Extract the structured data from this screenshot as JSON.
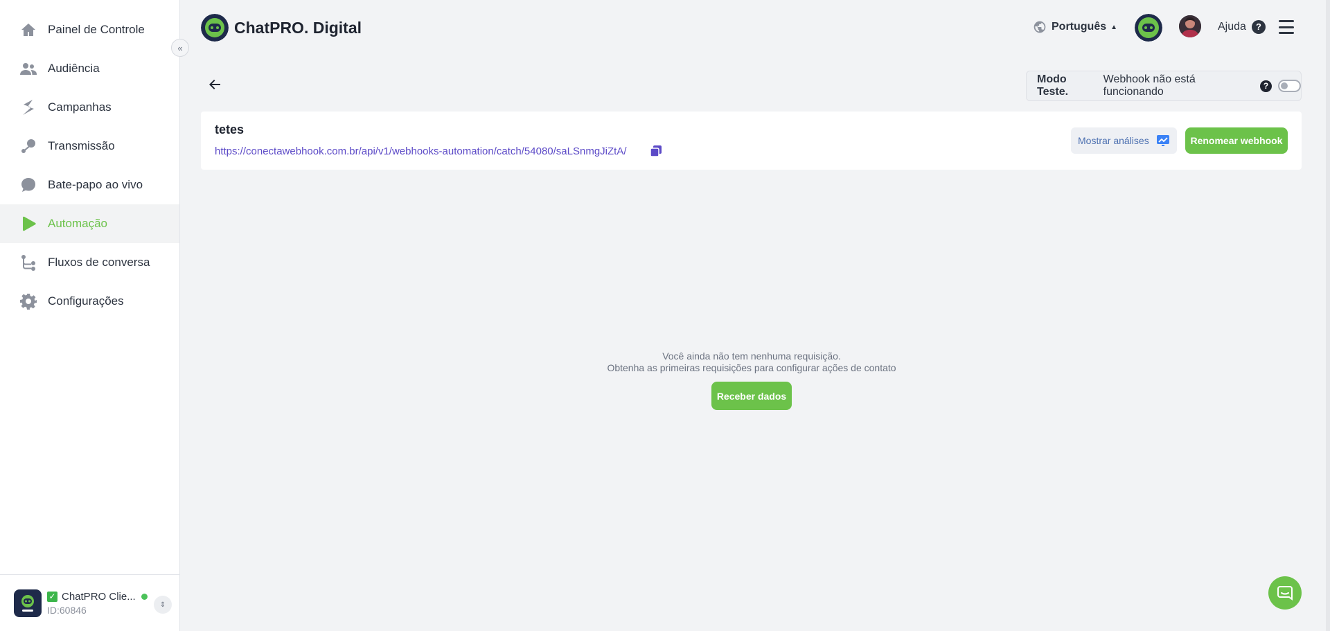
{
  "brand": {
    "name": "ChatPRO. Digital"
  },
  "sidebar": {
    "items": [
      {
        "label": "Painel de Controle",
        "icon": "home-icon"
      },
      {
        "label": "Audiência",
        "icon": "people-icon"
      },
      {
        "label": "Campanhas",
        "icon": "campaign-icon"
      },
      {
        "label": "Transmissão",
        "icon": "broadcast-icon"
      },
      {
        "label": "Bate-papo ao vivo",
        "icon": "chat-bubble-icon"
      },
      {
        "label": "Automação",
        "icon": "play-icon",
        "active": true
      },
      {
        "label": "Fluxos de conversa",
        "icon": "flow-icon"
      },
      {
        "label": "Configurações",
        "icon": "gear-icon"
      }
    ],
    "collapse_glyph": "«"
  },
  "account": {
    "name": "ChatPRO Clie...",
    "id": "ID:60846",
    "check_glyph": "✓",
    "switch_glyph": "⇕"
  },
  "header": {
    "language": "Português",
    "help_label": "Ajuda",
    "help_glyph": "?"
  },
  "test_mode": {
    "label": "Modo Teste.",
    "status": "Webhook não está funcionando",
    "enabled": false
  },
  "webhook": {
    "title": "tetes",
    "url": "https://conectawebhook.com.br/api/v1/webhooks-automation/catch/54080/saLSnmgJiZtA/",
    "analytics_label": "Mostrar análises",
    "rename_label": "Renomear webhook"
  },
  "empty_state": {
    "line1": "Você ainda não tem nenhuma requisição.",
    "line2": "Obtenha as primeiras requisições para configurar ações de contato",
    "button": "Receber dados"
  },
  "colors": {
    "accent_green": "#6cc24a",
    "link_purple": "#5c4ac7",
    "brand_navy": "#1e2a4a"
  }
}
